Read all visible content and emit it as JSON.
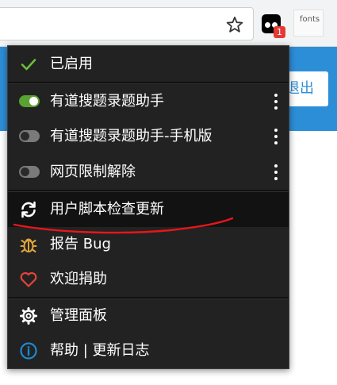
{
  "browser": {
    "extension_badge": "1",
    "fonts_extension_label": "fonts"
  },
  "page": {
    "logout_label": "退出"
  },
  "menu": {
    "enabled_label": "已启用",
    "scripts": [
      {
        "name": "有道搜题录题助手",
        "enabled": true
      },
      {
        "name": "有道搜题录题助手-手机版",
        "enabled": false
      },
      {
        "name": "网页限制解除",
        "enabled": false
      }
    ],
    "check_updates_label": "用户脚本检查更新",
    "report_bug_label": "报告 Bug",
    "donate_label": "欢迎捐助",
    "dashboard_label": "管理面板",
    "help_label": "帮助 | 更新日志"
  },
  "colors": {
    "menu_background": "#222222",
    "toggle_on": "#5aa232",
    "toggle_off": "#7a7a7a",
    "check": "#6bbf3b",
    "bug_icon": "#e0a43a",
    "heart_icon": "#e4413b",
    "info_icon": "#1e88d0",
    "annotation": "#e8161a",
    "page_banner": "#2d8ed8"
  },
  "icons": {
    "enabled": "check-icon",
    "update": "refresh-icon",
    "bug": "bug-icon",
    "donate": "heart-icon",
    "dashboard": "gear-icon",
    "help": "info-icon",
    "bookmark": "star-icon",
    "more": "kebab-icon"
  }
}
